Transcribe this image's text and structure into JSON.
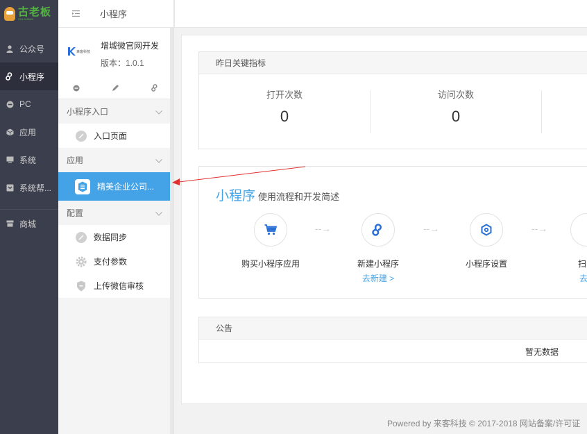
{
  "brand": {
    "name": "古老板",
    "tagline": "GULAOBAN"
  },
  "leftnav": [
    {
      "name": "nav-gongzhonghao",
      "label": "公众号",
      "icon": "user-icon"
    },
    {
      "name": "nav-xiaochengxu",
      "label": "小程序",
      "icon": "link-icon",
      "active": true
    },
    {
      "name": "nav-pc",
      "label": "PC",
      "icon": "pc-icon"
    },
    {
      "name": "nav-yingyong",
      "label": "应用",
      "icon": "box-icon"
    },
    {
      "name": "nav-xitong",
      "label": "系统",
      "icon": "monitor-icon"
    },
    {
      "name": "nav-help",
      "label": "系统帮...",
      "icon": "help-icon"
    },
    {
      "name": "nav-shangcheng",
      "label": "商城",
      "icon": "store-icon"
    }
  ],
  "subnav": {
    "title": "小程序",
    "app": {
      "name": "增城微官网开发",
      "version": "版本：1.0.1",
      "logo_text": "来客科技"
    },
    "sections": [
      {
        "title": "小程序入口",
        "items": [
          {
            "label": "入口页面"
          }
        ]
      },
      {
        "title": "应用",
        "items": [
          {
            "label": "精美企业公司...",
            "active": true
          }
        ]
      },
      {
        "title": "配置",
        "items": [
          {
            "label": "数据同步"
          },
          {
            "label": "支付参数"
          },
          {
            "label": "上传微信审核"
          }
        ]
      }
    ]
  },
  "metrics": {
    "header": "昨日关键指标",
    "items": [
      {
        "label": "打开次数",
        "value": "0"
      },
      {
        "label": "访问次数",
        "value": "0"
      }
    ]
  },
  "intro": {
    "title_big": "小程序",
    "title_small": "使用流程和开发简述",
    "steps": [
      {
        "label": "购买小程序应用",
        "link": ""
      },
      {
        "label": "新建小程序",
        "link": "去新建 >"
      },
      {
        "label": "小程序设置",
        "link": ""
      },
      {
        "label": "扫",
        "link": "去"
      }
    ]
  },
  "notice": {
    "header": "公告",
    "empty": "暂无数据"
  },
  "footer": "Powered by 来客科技 © 2017-2018 网站备案/许可证",
  "colors": {
    "accent": "#44a3e6",
    "nav_bg": "#3a3e4d",
    "brand_green": "#52b340"
  }
}
